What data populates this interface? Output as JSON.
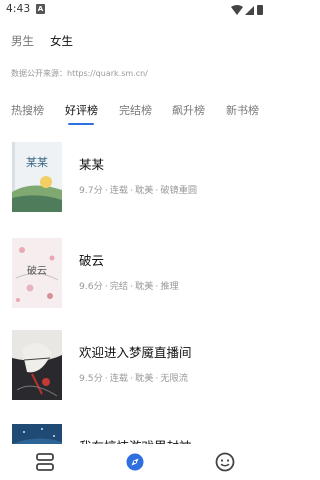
{
  "status_bar": {
    "time": "4:43",
    "notification_letter": "A"
  },
  "gender_tabs": {
    "male": "男生",
    "female": "女生"
  },
  "source_text": "数据公开来源：https://quark.sm.cn/",
  "category_tabs": [
    "热搜榜",
    "好评榜",
    "完结榜",
    "飙升榜",
    "新书榜"
  ],
  "active_category": "好评榜",
  "books": [
    {
      "title": "某某",
      "score": "9.7分",
      "status": "连载",
      "genre": "耽美",
      "tag": "破镜重圆",
      "cover_text": "某某"
    },
    {
      "title": "破云",
      "score": "9.6分",
      "status": "完结",
      "genre": "耽美",
      "tag": "推理",
      "cover_text": "破云"
    },
    {
      "title": "欢迎进入梦魇直播间",
      "score": "9.5分",
      "status": "连载",
      "genre": "耽美",
      "tag": "无限流",
      "cover_text": ""
    },
    {
      "title": "我在惊悚游戏里封神",
      "score": "",
      "status": "",
      "genre": "",
      "tag": "",
      "cover_text": ""
    }
  ],
  "separator": "·",
  "bottom_nav": [
    "bookshelf-icon",
    "discover-compass-icon",
    "profile-face-icon"
  ],
  "colors": {
    "accent": "#2f6fe0",
    "text_primary": "#111111",
    "text_secondary": "#999999"
  }
}
